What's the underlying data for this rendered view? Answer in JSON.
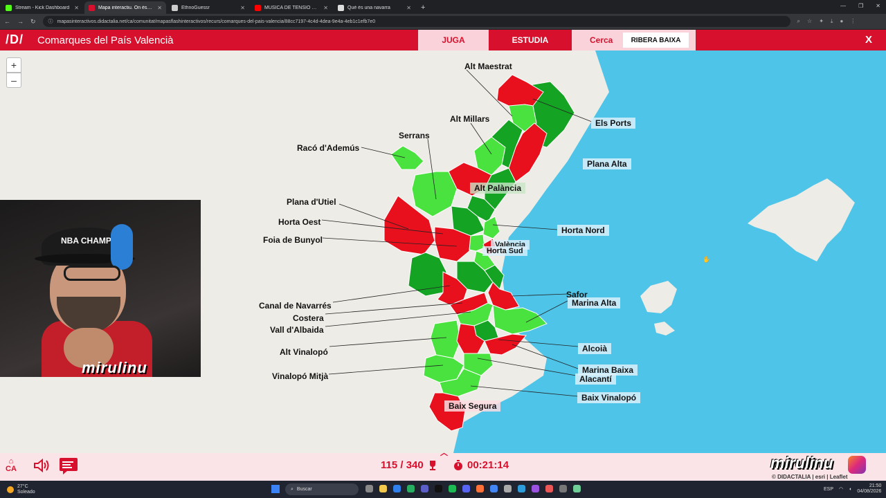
{
  "browser": {
    "tabs": [
      {
        "title": "Stream - Kick Dashboard",
        "color": "#53fc18",
        "active": false
      },
      {
        "title": "Mapa interactiu. On és? Comar",
        "color": "#d7102d",
        "active": true
      },
      {
        "title": "EthnoGuessr",
        "color": "#cccccc",
        "active": false
      },
      {
        "title": "MÚSICA DE TENSIÓ D'\"EL",
        "color": "#ff0000",
        "active": false
      },
      {
        "title": "Què és una navarra",
        "color": "#dddddd",
        "active": false
      }
    ],
    "url": "mapasinteractivos.didactalia.net/ca/comunitat/mapasflashinteractivos/recurs/comarques-del-pais-valencia/88cc7197-4c4d-4dea-9e4a-4eb1c1efb7e0"
  },
  "app": {
    "logo": "/D/",
    "title": "Comarques del País Valencià",
    "modes": {
      "play": "JUGA",
      "study": "ESTUDIA",
      "search": "Cerca"
    },
    "target": "RIBERA BAIXA",
    "close": "X"
  },
  "map": {
    "zoom_in": "+",
    "zoom_out": "–",
    "colors": {
      "correct": "#49e23f",
      "first_try": "#15a324",
      "wrong": "#e8101d",
      "sea": "#4ec4e8",
      "land": "#eeece6"
    },
    "labels": [
      {
        "name": "Alt Maestrat"
      },
      {
        "name": "Els Ports"
      },
      {
        "name": "Alt Millars"
      },
      {
        "name": "Serrans"
      },
      {
        "name": "Racó d'Ademús"
      },
      {
        "name": "Plana Alta"
      },
      {
        "name": "Alt Palància"
      },
      {
        "name": "Plana d'Utiel"
      },
      {
        "name": "Horta Oest"
      },
      {
        "name": "Horta Nord"
      },
      {
        "name": "Foia de Bunyol"
      },
      {
        "name": "València"
      },
      {
        "name": "Horta Sud"
      },
      {
        "name": "Safor"
      },
      {
        "name": "Marina Alta"
      },
      {
        "name": "Canal de Navarrés"
      },
      {
        "name": "Costera"
      },
      {
        "name": "Vall d'Albaida"
      },
      {
        "name": "Alcoià"
      },
      {
        "name": "Alt Vinalopó"
      },
      {
        "name": "Marina Baixa"
      },
      {
        "name": "Alacantí"
      },
      {
        "name": "Vinalopó Mitjà"
      },
      {
        "name": "Baix Vinalopó"
      },
      {
        "name": "Baix Segura"
      }
    ]
  },
  "webcam": {
    "cap_text": "NBA CHAMPS",
    "overlay": "mirulinu"
  },
  "footer": {
    "lang": "CA",
    "score": "115 / 340",
    "timer": "00:21:14",
    "brand": "mirulinu",
    "credits": "© DIDACTALIA | esri | Leaflet"
  },
  "taskbar": {
    "temp": "27°C",
    "weather": "Soleado",
    "search": "Buscar",
    "lang": "ESP",
    "time": "21:50",
    "date": "04/08/2026"
  }
}
